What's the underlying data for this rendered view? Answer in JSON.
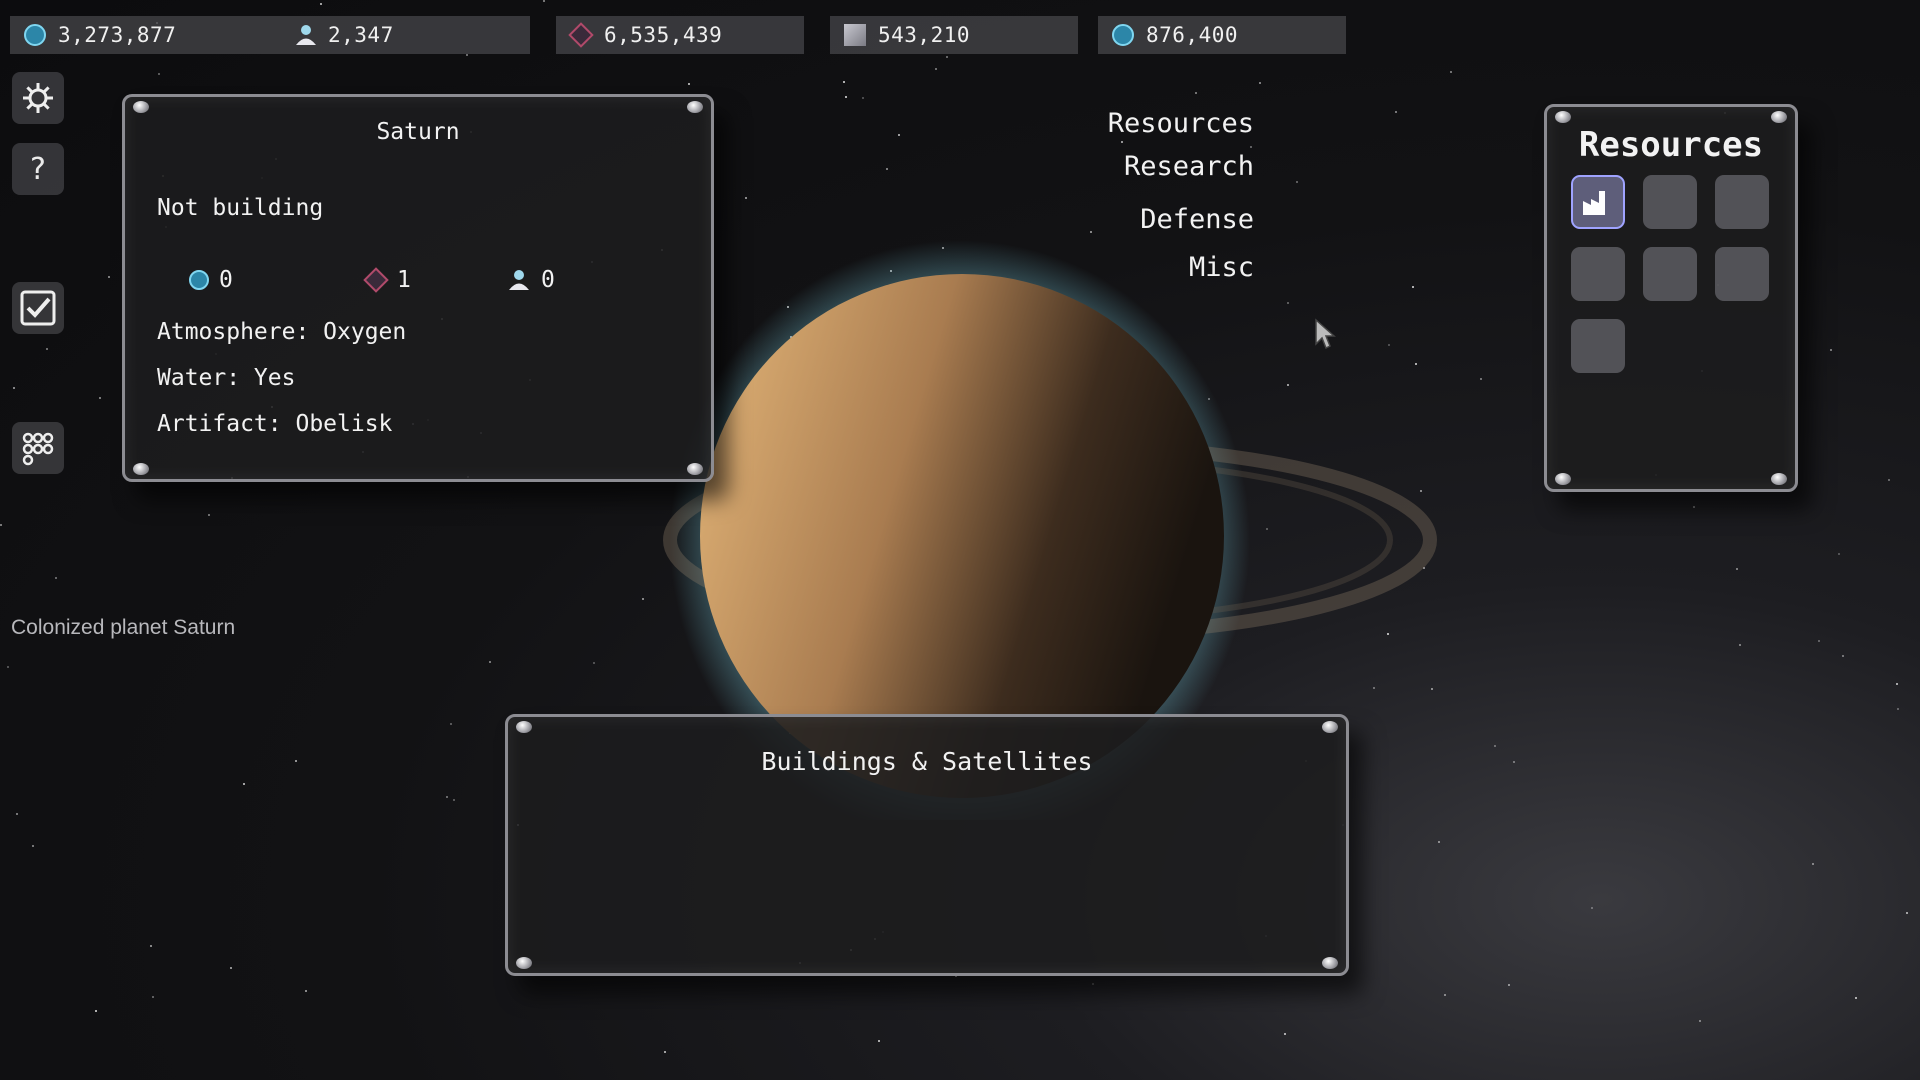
{
  "resources_bar": [
    {
      "icon": "credits-icon",
      "value": "3,273,877"
    },
    {
      "icon": "population-icon",
      "value": "2,347"
    },
    {
      "icon": "crystal-icon",
      "value": "6,535,439"
    },
    {
      "icon": "metal-icon",
      "value": "543,210"
    },
    {
      "icon": "energy-icon",
      "value": "876,400"
    }
  ],
  "tools": {
    "settings": "settings-gear-icon",
    "help": "?",
    "tasks": "checkbox-icon",
    "grid": "dots-grid-icon"
  },
  "planet_panel": {
    "title": "Saturn",
    "status": "Not building",
    "stats": [
      {
        "icon": "credits-icon",
        "value": "0"
      },
      {
        "icon": "crystal-icon",
        "value": "1"
      },
      {
        "icon": "population-icon",
        "value": "0"
      }
    ],
    "atmosphere": "Atmosphere: Oxygen",
    "water": "Water: Yes",
    "artifact": "Artifact: Obelisk"
  },
  "categories": {
    "resources": "Resources",
    "research": "Research",
    "defense": "Defense",
    "misc": "Misc"
  },
  "resources_panel": {
    "title": "Resources",
    "slots": 7,
    "active_slot": 0
  },
  "buildings_panel": {
    "title": "Buildings & Satellites"
  },
  "status_text": "Colonized planet Saturn",
  "colors": {
    "accent": "#7fd6f0",
    "crystal": "#b04a6a",
    "panel_border": "#8c8c92",
    "planet": "#c89258"
  }
}
